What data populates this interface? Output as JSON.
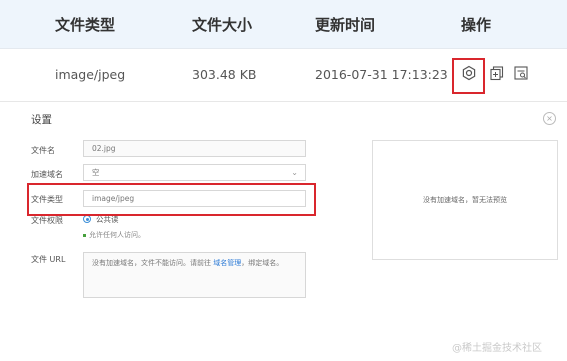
{
  "table": {
    "headers": [
      "文件类型",
      "文件大小",
      "更新时间",
      "操作"
    ],
    "row": {
      "type": "image/jpeg",
      "size": "303.48 KB",
      "updated": "2016-07-31 17:13:23"
    },
    "actions": [
      {
        "icon": "gear-icon"
      },
      {
        "icon": "copy-icon"
      },
      {
        "icon": "image-icon"
      }
    ]
  },
  "panel": {
    "title": "设置",
    "close": "×",
    "fields": {
      "name_label": "文件名",
      "name_value": "02.jpg",
      "domain_label": "加速域名",
      "domain_value": "空",
      "type_label": "文件类型",
      "type_value": "image/jpeg",
      "perm_label": "文件权限",
      "perm_option": "公共读",
      "perm_hint": "允许任何人访问。",
      "url_label": "文件 URL",
      "url_text_1": "没有加速域名，文件不能访问。请前往 ",
      "url_link": "域名管理",
      "url_text_2": "，绑定域名。"
    },
    "preview_text": "没有加速域名，暂无法预览"
  },
  "watermark": "@稀土掘金技术社区",
  "colors": {
    "header_bg": "#eef5fc",
    "highlight": "#d9262d",
    "link": "#2d7bd6"
  }
}
